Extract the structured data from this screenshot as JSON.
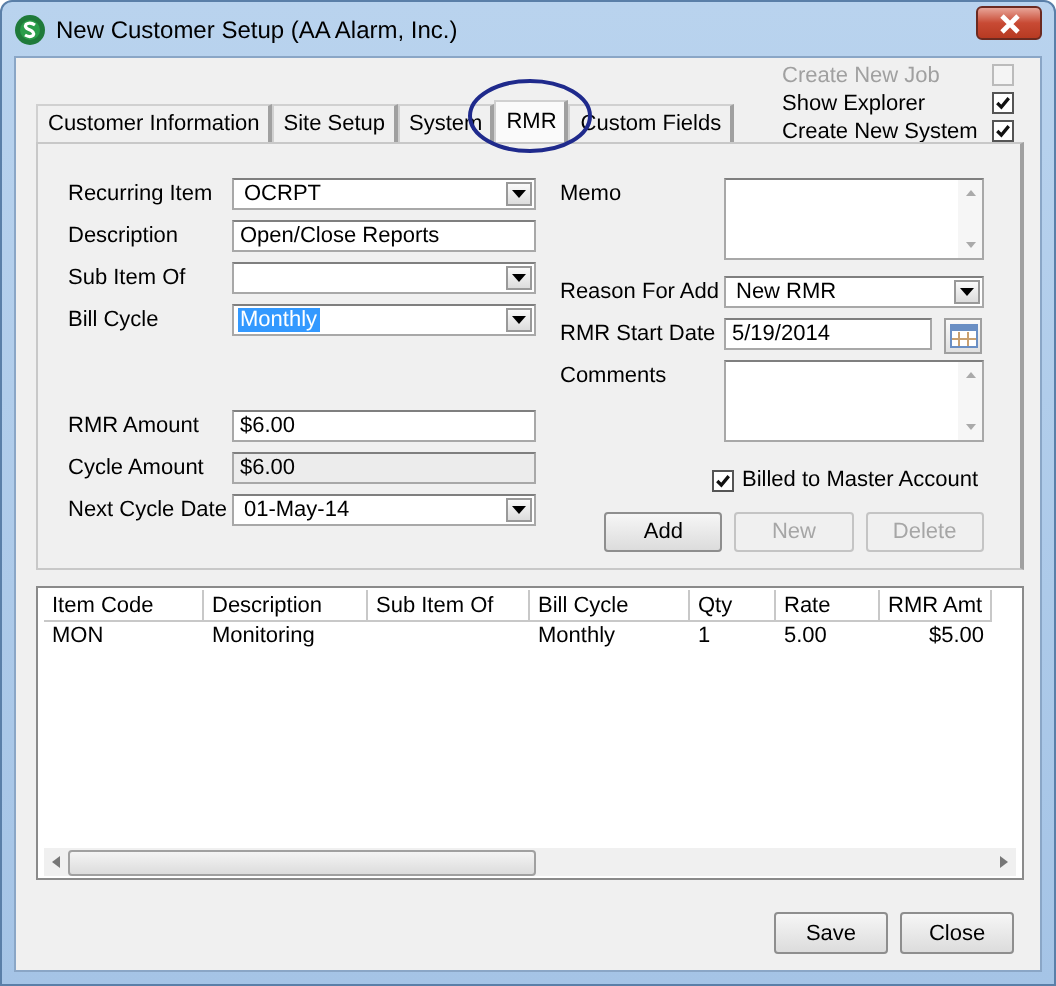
{
  "window": {
    "title": "New Customer Setup (AA Alarm, Inc.)"
  },
  "options": [
    {
      "label": "Create New Job",
      "checked": false,
      "disabled": true
    },
    {
      "label": "Show Explorer",
      "checked": true,
      "disabled": false
    },
    {
      "label": "Create New System",
      "checked": true,
      "disabled": false
    }
  ],
  "tabs": [
    {
      "label": "Customer Information",
      "selected": false
    },
    {
      "label": "Site Setup",
      "selected": false
    },
    {
      "label": "System",
      "selected": false
    },
    {
      "label": "RMR",
      "selected": true,
      "circled": true
    },
    {
      "label": "Custom Fields",
      "selected": false
    }
  ],
  "left_fields": [
    {
      "label": "Recurring Item",
      "kind": "dropdown",
      "value": "OCRPT"
    },
    {
      "label": "Description",
      "kind": "text",
      "value": "Open/Close Reports"
    },
    {
      "label": "Sub Item Of",
      "kind": "dropdown"
    },
    {
      "label": "Bill Cycle",
      "kind": "dropdown",
      "value": "Monthly",
      "highlighted": true
    },
    {
      "kind": "spacer"
    },
    {
      "label": "RMR Amount",
      "kind": "text",
      "value": "$6.00"
    },
    {
      "label": "Cycle Amount",
      "kind": "readonly",
      "value": "$6.00"
    },
    {
      "label": "Next Cycle Date",
      "kind": "dropdown",
      "value": "01-May-14"
    }
  ],
  "right_fields": [
    {
      "label": "Memo",
      "kind": "textarea"
    },
    {
      "label": "Reason For Add",
      "kind": "dropdown",
      "value": "New RMR"
    },
    {
      "label": "RMR Start Date",
      "kind": "date",
      "value": "5/19/2014"
    },
    {
      "label": "Comments",
      "kind": "textarea"
    }
  ],
  "billed_to_master": {
    "label": "Billed to Master Account",
    "checked": true
  },
  "item_buttons": [
    {
      "label": "Add",
      "disabled": false
    },
    {
      "label": "New",
      "disabled": true
    },
    {
      "label": "Delete",
      "disabled": true
    }
  ],
  "table": {
    "columns": [
      "Item Code",
      "Description",
      "Sub Item Of",
      "Bill Cycle",
      "Qty",
      "Rate",
      "RMR Amt"
    ],
    "rows": [
      [
        "MON",
        "Monitoring",
        "",
        "Monthly",
        "1",
        "5.00",
        "$5.00"
      ]
    ]
  },
  "buttons": [
    "Save",
    "Close"
  ]
}
